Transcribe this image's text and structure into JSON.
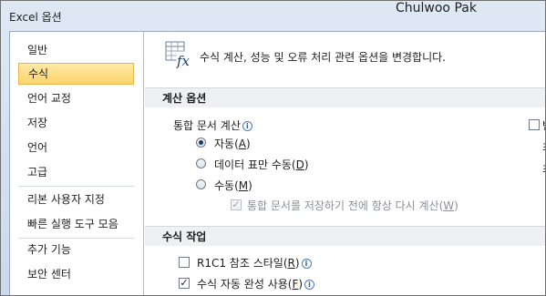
{
  "window": {
    "title": "Excel 옵션",
    "user": "Chulwoo Pak"
  },
  "sidebar": {
    "items": [
      {
        "label": "일반"
      },
      {
        "label": "수식"
      },
      {
        "label": "언어 교정"
      },
      {
        "label": "저장"
      },
      {
        "label": "언어"
      },
      {
        "label": "고급"
      },
      {
        "label": "리본 사용자 지정"
      },
      {
        "label": "빠른 실행 도구 모음"
      },
      {
        "label": "추가 기능"
      },
      {
        "label": "보안 센터"
      }
    ],
    "selected": "수식"
  },
  "content": {
    "header": "수식 계산, 성능 및 오류 처리 관련 옵션을 변경합니다.",
    "calc_section": {
      "title": "계산 옵션",
      "workbook_label": "통합 문서 계산",
      "auto": "자동",
      "auto_key": "A",
      "auto_except_tables": "데이터 표만 수동",
      "auto_except_tables_key": "D",
      "manual": "수동",
      "manual_key": "M",
      "recalc_before_save": "통합 문서를 저장하기 전에 항상 다시 계산",
      "recalc_key": "W",
      "right_col_chars": [
        "반",
        "최",
        "최"
      ]
    },
    "formula_section": {
      "title": "수식 작업",
      "r1c1": "R1C1 참조 스타일",
      "r1c1_key": "R",
      "autocomplete": "수식 자동 완성 사용",
      "autocomplete_key": "F"
    },
    "info_glyph": "i"
  }
}
